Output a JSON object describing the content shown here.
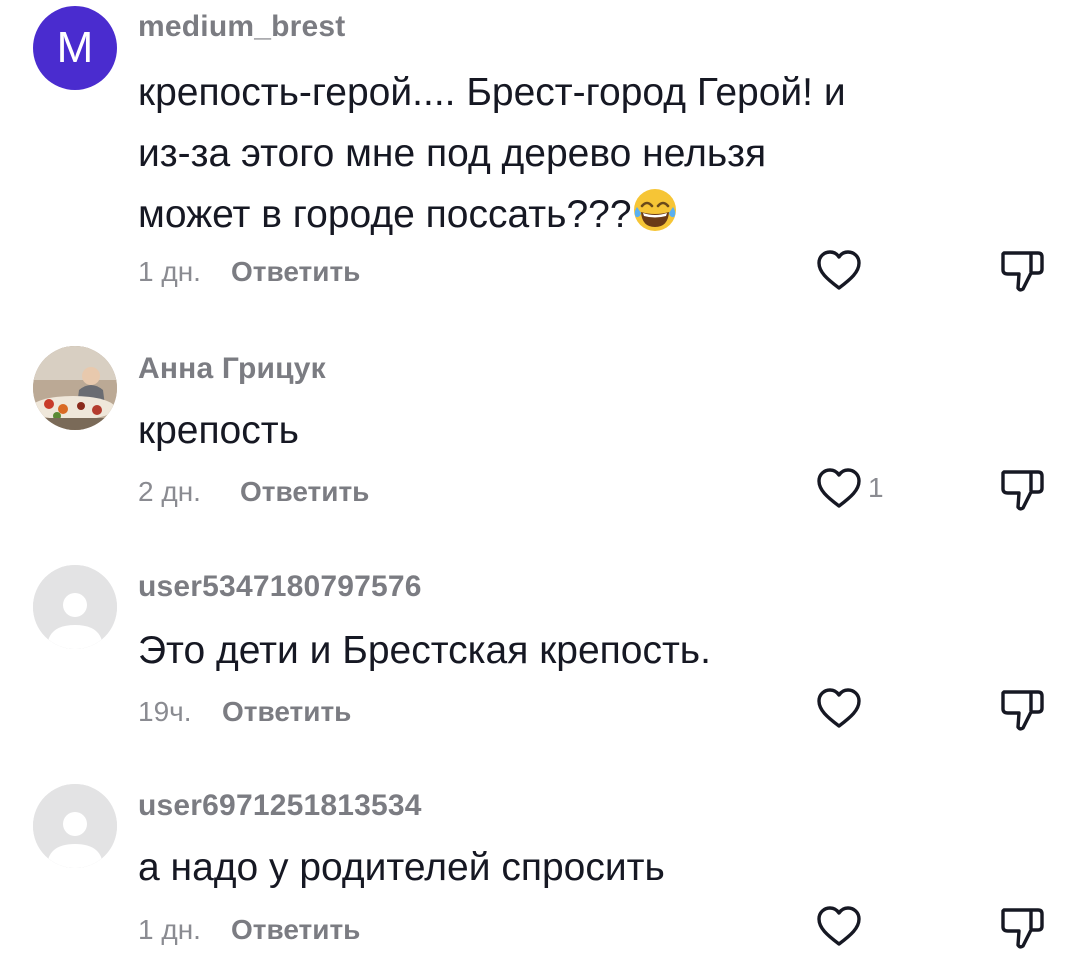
{
  "comments": [
    {
      "avatar_letter": "M",
      "username": "medium_brest",
      "text_lines": [
        "крепость-герой.... Брест-город Герой! и",
        "из-за этого мне под дерево нельзя",
        "может в городе поссать???"
      ],
      "emoji": "face-with-tears-of-joy",
      "time": "1 дн.",
      "reply_label": "Ответить",
      "likes": ""
    },
    {
      "username": "Анна Грицук",
      "text_lines": [
        "крепость"
      ],
      "time": "2 дн.",
      "reply_label": "Ответить",
      "likes": "1"
    },
    {
      "username": "user5347180797576",
      "text_lines": [
        "Это дети и Брестская крепость."
      ],
      "time": "19ч.",
      "reply_label": "Ответить",
      "likes": ""
    },
    {
      "username": "user6971251813534",
      "text_lines": [
        "а надо у родителей спросить"
      ],
      "time": "1 дн.",
      "reply_label": "Ответить",
      "likes": ""
    }
  ],
  "colors": {
    "avatar_letter_bg": "#4a2ccf",
    "username": "#7b7c82",
    "text": "#161823",
    "meta": "#8a8b91"
  },
  "icons": [
    "heart-outline-icon",
    "thumbs-down-outline-icon",
    "default-avatar-icon",
    "face-with-tears-of-joy-emoji"
  ]
}
